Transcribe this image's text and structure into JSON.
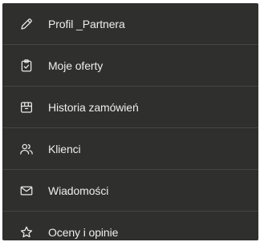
{
  "menu": {
    "items": [
      {
        "label": "Profil _Partnera",
        "icon": "pencil-icon"
      },
      {
        "label": "Moje oferty",
        "icon": "clipboard-check-icon"
      },
      {
        "label": "Historia zamówień",
        "icon": "archive-box-icon"
      },
      {
        "label": "Klienci",
        "icon": "users-icon"
      },
      {
        "label": "Wiadomości",
        "icon": "envelope-icon"
      },
      {
        "label": "Oceny i opinie",
        "icon": "star-icon"
      }
    ]
  },
  "colors": {
    "background": "#2f2f2e",
    "divider": "#454544",
    "text": "#ededeb"
  }
}
